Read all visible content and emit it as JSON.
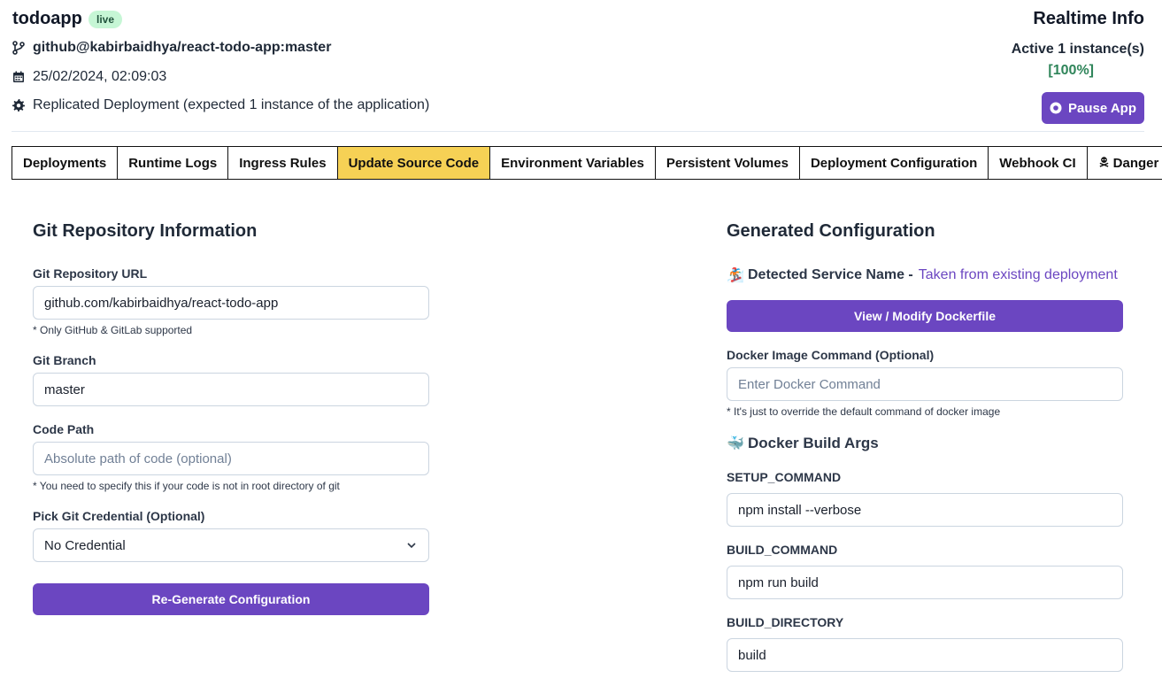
{
  "app": {
    "name": "todoapp",
    "status_badge": "live",
    "repo": "github@kabirbaidhya/react-todo-app:master",
    "timestamp": "25/02/2024, 02:09:03",
    "deployment_type": "Replicated Deployment (expected 1 instance of the application)"
  },
  "realtime": {
    "title": "Realtime Info",
    "instances": "Active 1 instance(s)",
    "percent": "[100%]",
    "pause_label": "Pause App"
  },
  "tabs": [
    {
      "label": "Deployments"
    },
    {
      "label": "Runtime Logs"
    },
    {
      "label": "Ingress Rules"
    },
    {
      "label": "Update Source Code",
      "active": true
    },
    {
      "label": "Environment Variables"
    },
    {
      "label": "Persistent Volumes"
    },
    {
      "label": "Deployment Configuration"
    },
    {
      "label": "Webhook CI"
    },
    {
      "label": "Danger Zone"
    }
  ],
  "git": {
    "title": "Git Repository Information",
    "url_label": "Git Repository URL",
    "url_value": "github.com/kabirbaidhya/react-todo-app",
    "url_hint": "* Only GitHub & GitLab supported",
    "branch_label": "Git Branch",
    "branch_value": "master",
    "code_path_label": "Code Path",
    "code_path_placeholder": "Absolute path of code (optional)",
    "code_path_hint": "* You need to specify this if your code is not in root directory of git",
    "credential_label": "Pick Git Credential (Optional)",
    "credential_value": "No Credential",
    "regenerate_label": "Re-Generate Configuration"
  },
  "config": {
    "title": "Generated Configuration",
    "detected_emoji": "🏂",
    "detected_label": "Detected Service Name -",
    "detected_value": "Taken from existing deployment",
    "dockerfile_label": "View / Modify Dockerfile",
    "docker_cmd_label": "Docker Image Command (Optional)",
    "docker_cmd_placeholder": "Enter Docker Command",
    "docker_cmd_hint": "* It's just to override the default command of docker image",
    "build_args_emoji": "🐳",
    "build_args_title": "Docker Build Args",
    "args": [
      {
        "name": "SETUP_COMMAND",
        "value": "npm install --verbose"
      },
      {
        "name": "BUILD_COMMAND",
        "value": "npm run build"
      },
      {
        "name": "BUILD_DIRECTORY",
        "value": "build"
      }
    ]
  },
  "icons": {
    "repo": "git-branch-icon",
    "date": "calendar-icon",
    "deploy": "gear-icon",
    "pause": "pause-circle-icon",
    "danger": "skull-crossbones-icon",
    "select": "chevron-down-icon"
  },
  "colors": {
    "accent": "#6b46c1",
    "active_tab": "#f6d155",
    "badge_bg": "#c6f6d5",
    "success": "#2f855a"
  }
}
